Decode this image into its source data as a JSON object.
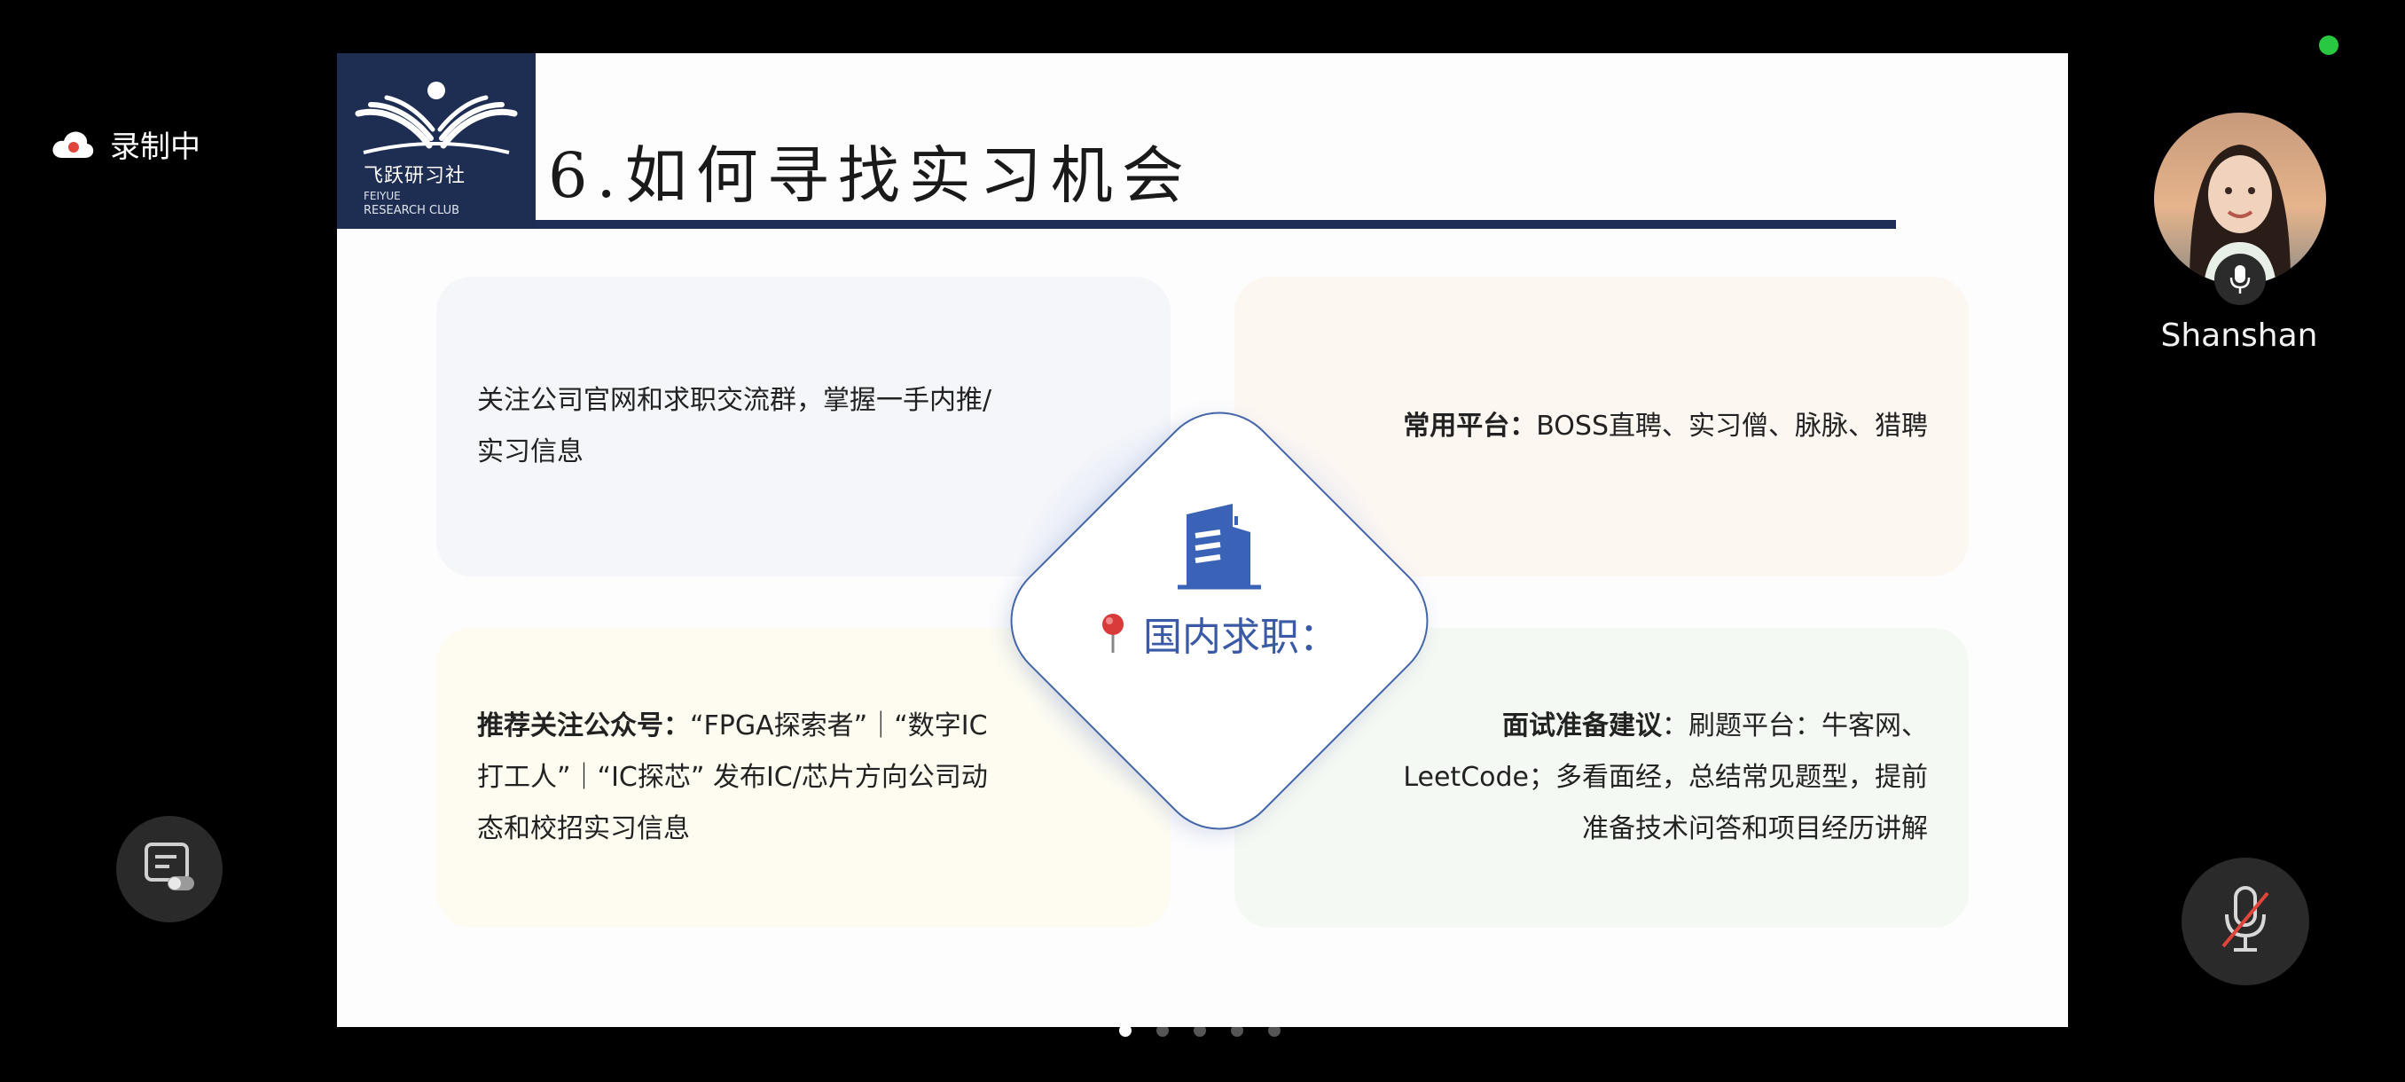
{
  "recording": {
    "label": "录制中",
    "icon": "cloud-icon"
  },
  "participant": {
    "name": "Shanshan",
    "mic_icon": "microphone-icon"
  },
  "status": {
    "dot_color": "#28c840"
  },
  "controls": {
    "left_icon": "captions-toggle-icon",
    "mic_icon": "microphone-muted-icon"
  },
  "pagination": {
    "total": 5,
    "active": 1
  },
  "slide": {
    "logo": {
      "zh": "飞跃研习社",
      "en_line1": "FEIYUE",
      "en_line2": "RESEARCH CLUB"
    },
    "title": "6.如何寻找实习机会",
    "center": {
      "icon": "building-icon",
      "pin_icon": "pushpin-icon",
      "label": "国内求职："
    },
    "cards": {
      "top_left": {
        "text": "关注公司官网和求职交流群，掌握一手内推/实习信息"
      },
      "top_right": {
        "bold": "常用平台：",
        "text": "BOSS直聘、实习僧、脉脉、猎聘"
      },
      "bottom_left": {
        "bold": "推荐关注公众号：",
        "text": "“FPGA探索者”｜“数字IC打工人”｜“IC探芯” 发布IC/芯片方向公司动态和校招实习信息"
      },
      "bottom_right": {
        "bold": "面试准备建议",
        "text": "：刷题平台：牛客网、LeetCode；多看面经，总结常见题型，提前准备技术问答和项目经历讲解"
      }
    },
    "accent_color": "#1f2e57",
    "center_color": "#3a5aa8"
  }
}
